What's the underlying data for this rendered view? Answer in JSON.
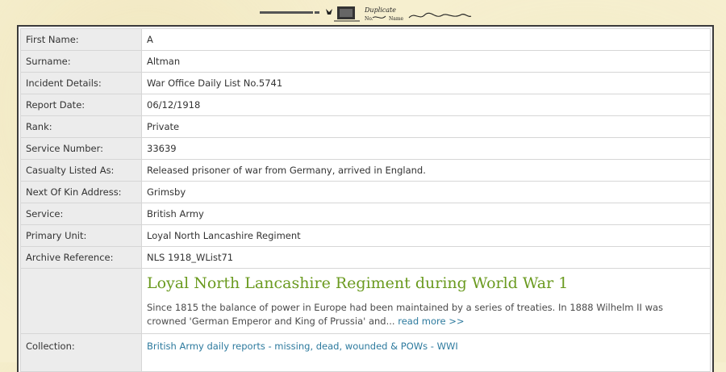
{
  "header": {
    "scan_words": [
      "Duplicate",
      "No.",
      "Name"
    ]
  },
  "record": [
    {
      "label": "First Name:",
      "value": "A"
    },
    {
      "label": "Surname:",
      "value": "Altman"
    },
    {
      "label": "Incident Details:",
      "value": "War Office Daily List No.5741"
    },
    {
      "label": "Report Date:",
      "value": "06/12/1918"
    },
    {
      "label": "Rank:",
      "value": "Private"
    },
    {
      "label": "Service Number:",
      "value": "33639"
    },
    {
      "label": "Casualty Listed As:",
      "value": "Released prisoner of war from Germany, arrived in England."
    },
    {
      "label": "Next Of Kin Address:",
      "value": "Grimsby"
    },
    {
      "label": "Service:",
      "value": "British Army"
    },
    {
      "label": "Primary Unit:",
      "value": "Loyal North Lancashire Regiment"
    },
    {
      "label": "Archive Reference:",
      "value": "NLS 1918_WList71"
    }
  ],
  "feature": {
    "title": "Loyal North Lancashire Regiment during World War 1",
    "text": "Since 1815 the balance of power in Europe had been maintained by a series of treaties. In 1888 Wilhelm II was crowned 'German Emperor and King of Prussia' and...",
    "read_more": "read more  >>"
  },
  "collection": {
    "label": "Collection:",
    "link": "British Army daily reports - missing, dead, wounded & POWs - WWI"
  }
}
